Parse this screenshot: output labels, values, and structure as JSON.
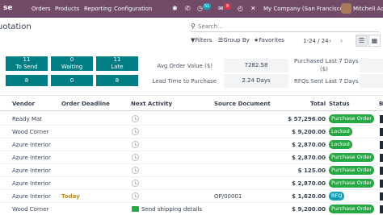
{
  "app": {
    "name": "se"
  },
  "nav": {
    "menus": [
      "Orders",
      "Products",
      "Reporting",
      "Configuration"
    ],
    "badges": {
      "activity": "51",
      "messages": "9"
    },
    "company": "My Company (San Francisco)",
    "user": "Mitchell Admin"
  },
  "page": {
    "title": "uotation"
  },
  "search": {
    "placeholder": "Search..."
  },
  "toolbar": {
    "filters": "Filters",
    "group_by": "Group By",
    "favorites": "Favorites",
    "pager": "1-24 / 24"
  },
  "dashboard": {
    "tiles": [
      {
        "count": "11",
        "label": "To Send",
        "my_count": "8"
      },
      {
        "count": "0",
        "label": "Waiting",
        "my_count": "0"
      },
      {
        "count": "11",
        "label": "Late",
        "my_count": "8"
      }
    ],
    "stats": [
      {
        "label": "Avg Order Value ($)",
        "value": "7282.58"
      },
      {
        "label": "Lead Time to Purchase",
        "value": "2.24  Days"
      },
      {
        "label": "Purchased Last 7 Days ($)",
        "value": ""
      },
      {
        "label": "RFQs Sent Last 7 Days",
        "value": ""
      }
    ]
  },
  "table": {
    "headers": [
      "Vendor",
      "Order Deadline",
      "Next Activity",
      "Source Document",
      "Total",
      "Status"
    ],
    "rows": [
      {
        "vendor": "Ready Mat",
        "deadline": "",
        "activity": "",
        "source": "",
        "total": "$ 57,296.00",
        "status": "Purchase Order",
        "status_type": "po"
      },
      {
        "vendor": "Wood Corner",
        "deadline": "",
        "activity": "",
        "source": "",
        "total": "$ 9,200.00",
        "status": "Locked",
        "status_type": "locked"
      },
      {
        "vendor": "Azure Interior",
        "deadline": "",
        "activity": "",
        "source": "",
        "total": "$ 2,870.00",
        "status": "Locked",
        "status_type": "locked"
      },
      {
        "vendor": "Azure Interior",
        "deadline": "",
        "activity": "",
        "source": "",
        "total": "$ 2,870.00",
        "status": "Purchase Order",
        "status_type": "po"
      },
      {
        "vendor": "Azure Interior",
        "deadline": "",
        "activity": "",
        "source": "",
        "total": "$ 125.00",
        "status": "Purchase Order",
        "status_type": "po"
      },
      {
        "vendor": "Azure Interior",
        "deadline": "",
        "activity": "",
        "source": "",
        "total": "$ 2,870.00",
        "status": "Purchase Order",
        "status_type": "po"
      },
      {
        "vendor": "Azure Interior",
        "deadline": "Today",
        "activity": "",
        "source": "OP/00001",
        "total": "$ 1,620.00",
        "status": "RFQ",
        "status_type": "rfq"
      },
      {
        "vendor": "Wood Corner",
        "deadline": "",
        "activity": "Send shipping details",
        "source": "",
        "total": "$ 9,200.00",
        "status": "Purchase Order",
        "status_type": "po"
      }
    ]
  },
  "colors": {
    "navbar": "#714b67",
    "tile": "#017e84",
    "badge_success": "#28a745",
    "badge_info": "#17a2b8",
    "today": "#c08a1b"
  }
}
